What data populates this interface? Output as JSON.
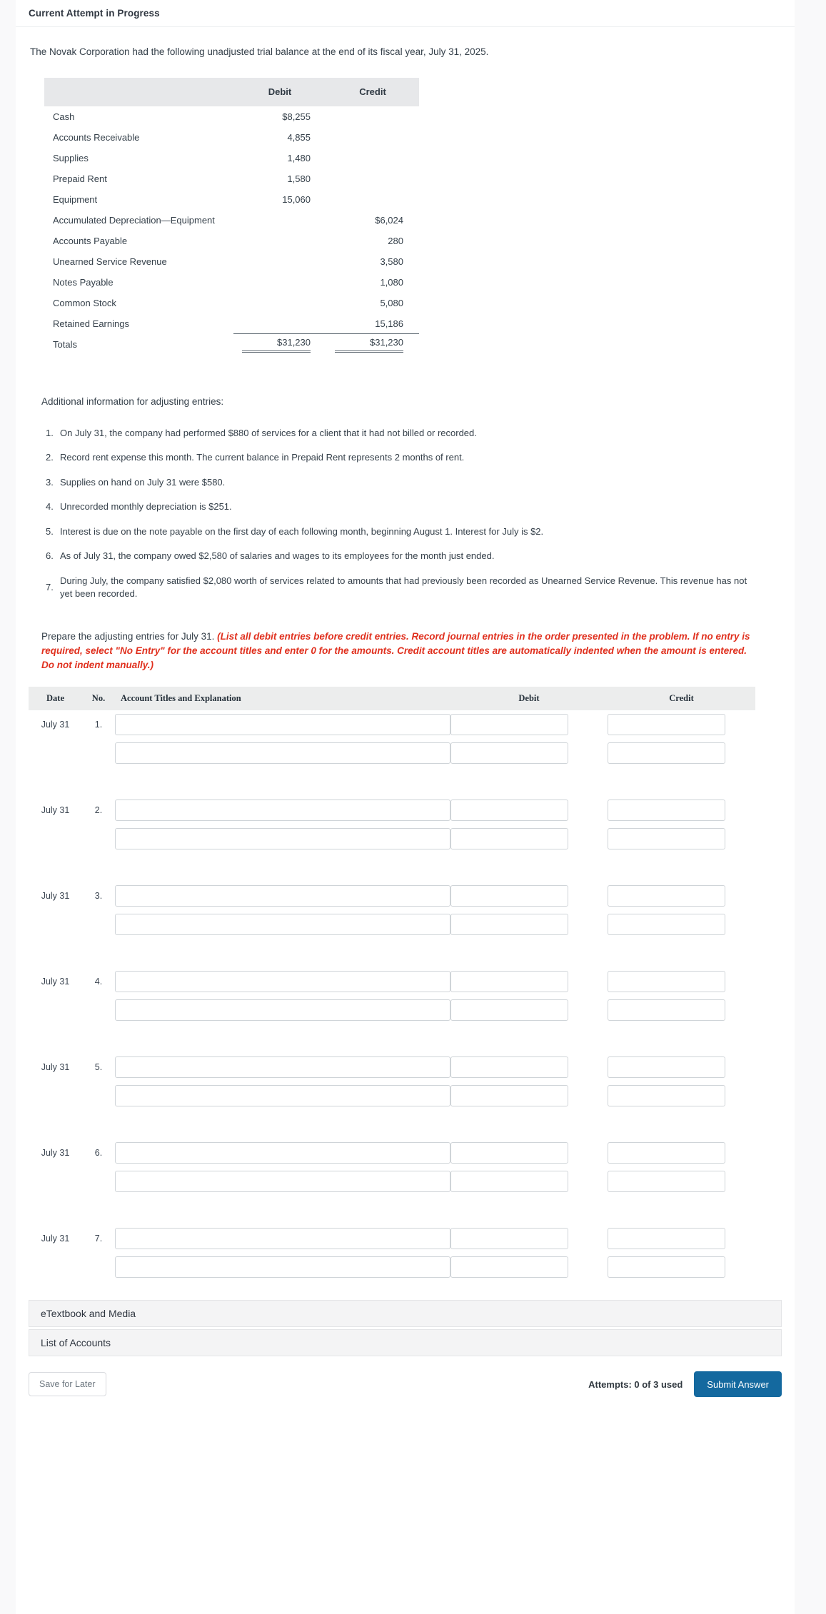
{
  "header": {
    "title": "Current Attempt in Progress"
  },
  "intro": "The Novak Corporation had the following unadjusted trial balance at the end of its fiscal year, July 31, 2025.",
  "trial_balance": {
    "columns": {
      "account": "",
      "debit": "Debit",
      "credit": "Credit"
    },
    "rows": [
      {
        "account": "Cash",
        "debit": "$8,255",
        "credit": ""
      },
      {
        "account": "Accounts Receivable",
        "debit": "4,855",
        "credit": ""
      },
      {
        "account": "Supplies",
        "debit": "1,480",
        "credit": ""
      },
      {
        "account": "Prepaid Rent",
        "debit": "1,580",
        "credit": ""
      },
      {
        "account": "Equipment",
        "debit": "15,060",
        "credit": ""
      },
      {
        "account": "Accumulated Depreciation—Equipment",
        "debit": "",
        "credit": "$6,024"
      },
      {
        "account": "Accounts Payable",
        "debit": "",
        "credit": "280"
      },
      {
        "account": "Unearned Service Revenue",
        "debit": "",
        "credit": "3,580"
      },
      {
        "account": "Notes Payable",
        "debit": "",
        "credit": "1,080"
      },
      {
        "account": "Common Stock",
        "debit": "",
        "credit": "5,080"
      },
      {
        "account": "Retained Earnings",
        "debit": "",
        "credit": "15,186"
      }
    ],
    "totals": {
      "account": "Totals",
      "debit": "$31,230",
      "credit": "$31,230"
    }
  },
  "additional": {
    "title": "Additional information for adjusting entries:",
    "items": [
      {
        "n": "1.",
        "text": "On July 31, the company had performed $880 of services for a client that it had not billed or recorded."
      },
      {
        "n": "2.",
        "text": "Record rent expense this month. The current balance in Prepaid Rent represents 2 months of rent."
      },
      {
        "n": "3.",
        "text": "Supplies on hand on July 31 were $580."
      },
      {
        "n": "4.",
        "text": "Unrecorded monthly depreciation is $251."
      },
      {
        "n": "5.",
        "text": "Interest is due on the note payable on the first day of each following month, beginning August 1. Interest for July is $2."
      },
      {
        "n": "6.",
        "text": "As of July 31, the company owed $2,580 of salaries and wages to its employees for the month just ended."
      },
      {
        "n": "7.",
        "text": "During July, the company satisfied $2,080 worth of services related to amounts that had previously been recorded as Unearned Service Revenue. This revenue has not yet been recorded."
      }
    ]
  },
  "prepare": {
    "lead": "Prepare the adjusting entries for July 31. ",
    "red": "(List all debit entries before credit entries. Record journal entries in the order presented in the problem. If no entry is required, select \"No Entry\" for the account titles and enter 0 for the amounts. Credit account titles are automatically indented when the amount is entered. Do not indent manually.)"
  },
  "journal": {
    "columns": {
      "date": "Date",
      "no": "No.",
      "account": "Account Titles and Explanation",
      "debit": "Debit",
      "credit": "Credit"
    },
    "entries": [
      {
        "date": "July 31",
        "no": "1.",
        "account_a": "",
        "debit_a": "",
        "credit_a": "",
        "account_b": "",
        "debit_b": "",
        "credit_b": ""
      },
      {
        "date": "July 31",
        "no": "2.",
        "account_a": "",
        "debit_a": "",
        "credit_a": "",
        "account_b": "",
        "debit_b": "",
        "credit_b": ""
      },
      {
        "date": "July 31",
        "no": "3.",
        "account_a": "",
        "debit_a": "",
        "credit_a": "",
        "account_b": "",
        "debit_b": "",
        "credit_b": ""
      },
      {
        "date": "July 31",
        "no": "4.",
        "account_a": "",
        "debit_a": "",
        "credit_a": "",
        "account_b": "",
        "debit_b": "",
        "credit_b": ""
      },
      {
        "date": "July 31",
        "no": "5.",
        "account_a": "",
        "debit_a": "",
        "credit_a": "",
        "account_b": "",
        "debit_b": "",
        "credit_b": ""
      },
      {
        "date": "July 31",
        "no": "6.",
        "account_a": "",
        "debit_a": "",
        "credit_a": "",
        "account_b": "",
        "debit_b": "",
        "credit_b": ""
      },
      {
        "date": "July 31",
        "no": "7.",
        "account_a": "",
        "debit_a": "",
        "credit_a": "",
        "account_b": "",
        "debit_b": "",
        "credit_b": ""
      }
    ]
  },
  "accordions": [
    {
      "label": "eTextbook and Media"
    },
    {
      "label": "List of Accounts"
    }
  ],
  "footer": {
    "save_label": "Save for Later",
    "attempts": "Attempts: 0 of 3 used",
    "submit_label": "Submit Answer"
  },
  "colors": {
    "submit_blue": "#14699f",
    "instruction_red": "#e0301e",
    "header_gray": "#e7e8ea",
    "page_bg": "#f9f9fa"
  }
}
